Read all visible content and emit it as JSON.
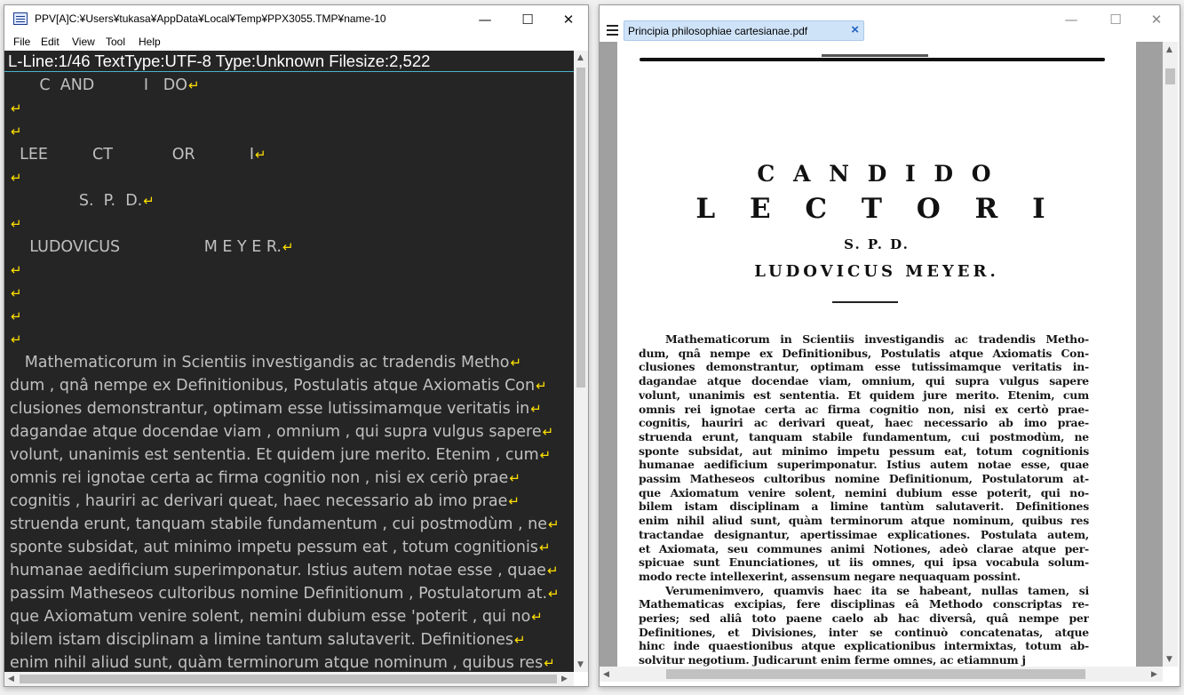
{
  "left_window": {
    "title": "PPV[A]C:¥Users¥tukasa¥AppData¥Local¥Temp¥PPX3055.TMP¥name-10",
    "controls": {
      "minimize": "—",
      "maximize": "☐",
      "close": "✕"
    },
    "menu": [
      "File",
      "Edit",
      "View",
      "Tool",
      "Help"
    ],
    "status_line": "L-Line:1/46 TextType:UTF-8  Type:Unknown Filesize:2,522",
    "return_glyph": "↵",
    "lines": [
      "      C  AND          I   DO",
      "",
      "",
      "  LEE         CT            OR           I",
      "",
      "              S.  P.  D.",
      "",
      "    LUDOVICUS                 M E Y E R.",
      "",
      "",
      "",
      "",
      "   Mathematicorum in Scientiis investigandis ac tradendis Metho",
      "dum , qnâ nempe ex Definitionibus, Postulatis atque Axiomatis Con",
      "clusiones demonstrantur, optimam esse lutissimamque veritatis in",
      "dagandae atque docendae viam , omnium , qui supra vulgus sapere",
      "volunt, unanimis est sententia. Et quidem jure merito. Etenim , cum",
      "omnis rei ignotae certa ac firma cognitio non , nisi ex ceriò prae",
      "cognitis , hauriri ac derivari queat, haec necessario ab imo prae",
      "struenda erunt, tanquam stabile fundamentum , cui postmodùm , ne",
      "sponte subsidat, aut minimo impetu pessum eat , totum cognitionis",
      "humanae aedificium superimponatur. Istius autem notae esse , quae",
      "passim Matheseos cultoribus nomine Definitionum , Postulatorum at.",
      "que Axiomatum venire solent, nemini dubium esse 'poterit , qui no",
      "bilem istam disciplinam a limine tantum salutaverit. Definitiones",
      "enim nihil aliud sunt, quàm terminorum atque nominum , quibus res"
    ]
  },
  "right_window": {
    "controls": {
      "minimize": "—",
      "maximize": "☐",
      "close": "✕"
    },
    "tab": {
      "label": "Principia philosophiae cartesianae.pdf",
      "close": "×"
    },
    "pdf": {
      "heading1": "C A N D I D O",
      "heading2": "L E C T O R I",
      "heading3": "S. P. D.",
      "heading4": "LUDOVICUS  MEYER.",
      "paragraph_lines": [
        "Mathematicorum in Scientiis investigandis ac tradendis Metho-",
        "dum, qnâ nempe ex Definitionibus, Postulatis atque Axiomatis Con-",
        "clusiones demonstrantur, optimam esse tutissimamque veritatis in-",
        "dagandae atque docendae viam, omnium, qui supra vulgus sapere",
        "volunt, unanimis est sententia. Et quidem jure merito. Etenim, cum",
        "omnis rei ignotae certa ac firma cognitio non, nisi ex certò prae-",
        "cognitis, hauriri ac derivari queat, haec necessario ab imo prae-",
        "struenda erunt, tanquam stabile fundamentum, cui postmodùm, ne",
        "sponte subsidat, aut minimo impetu pessum eat, totum cognitionis",
        "humanae aedificium superimponatur. Istius autem notae esse, quae",
        "passim Matheseos cultoribus nomine Definitionum, Postulatorum at-",
        "que Axiomatum venire solent, nemini dubium esse poterit, qui no-",
        "bilem istam disciplinam a limine tantùm salutaverit. Definitiones",
        "enim nihil aliud sunt, quàm terminorum atque nominum, quibus res",
        "tractandae designantur, apertissimae explicationes. Postulata autem,",
        "et Axiomata, seu communes animi Notiones, adeò clarae atque per-",
        "spicuae sunt Enunciationes, ut iis omnes, qui ipsa vocabula solum-",
        "modo recte intellexerint, assensum negare nequaquam possint.",
        "Verumenimvero, quamvis haec ita se habeant, nullas tamen, si",
        "Mathematicas excipias, fere disciplinas eâ Methodo conscriptas re-",
        "peries; sed aliâ toto paene caelo ab hac diversâ, quâ nempe per",
        "Definitiones, et Divisiones, inter se continuò concatenatas, atque",
        "hinc inde quaestionibus atque explicationibus intermixtas, totum ab-",
        "solvitur negotium. Judicarunt enim ferme omnes, ac etiamnum j"
      ]
    }
  }
}
